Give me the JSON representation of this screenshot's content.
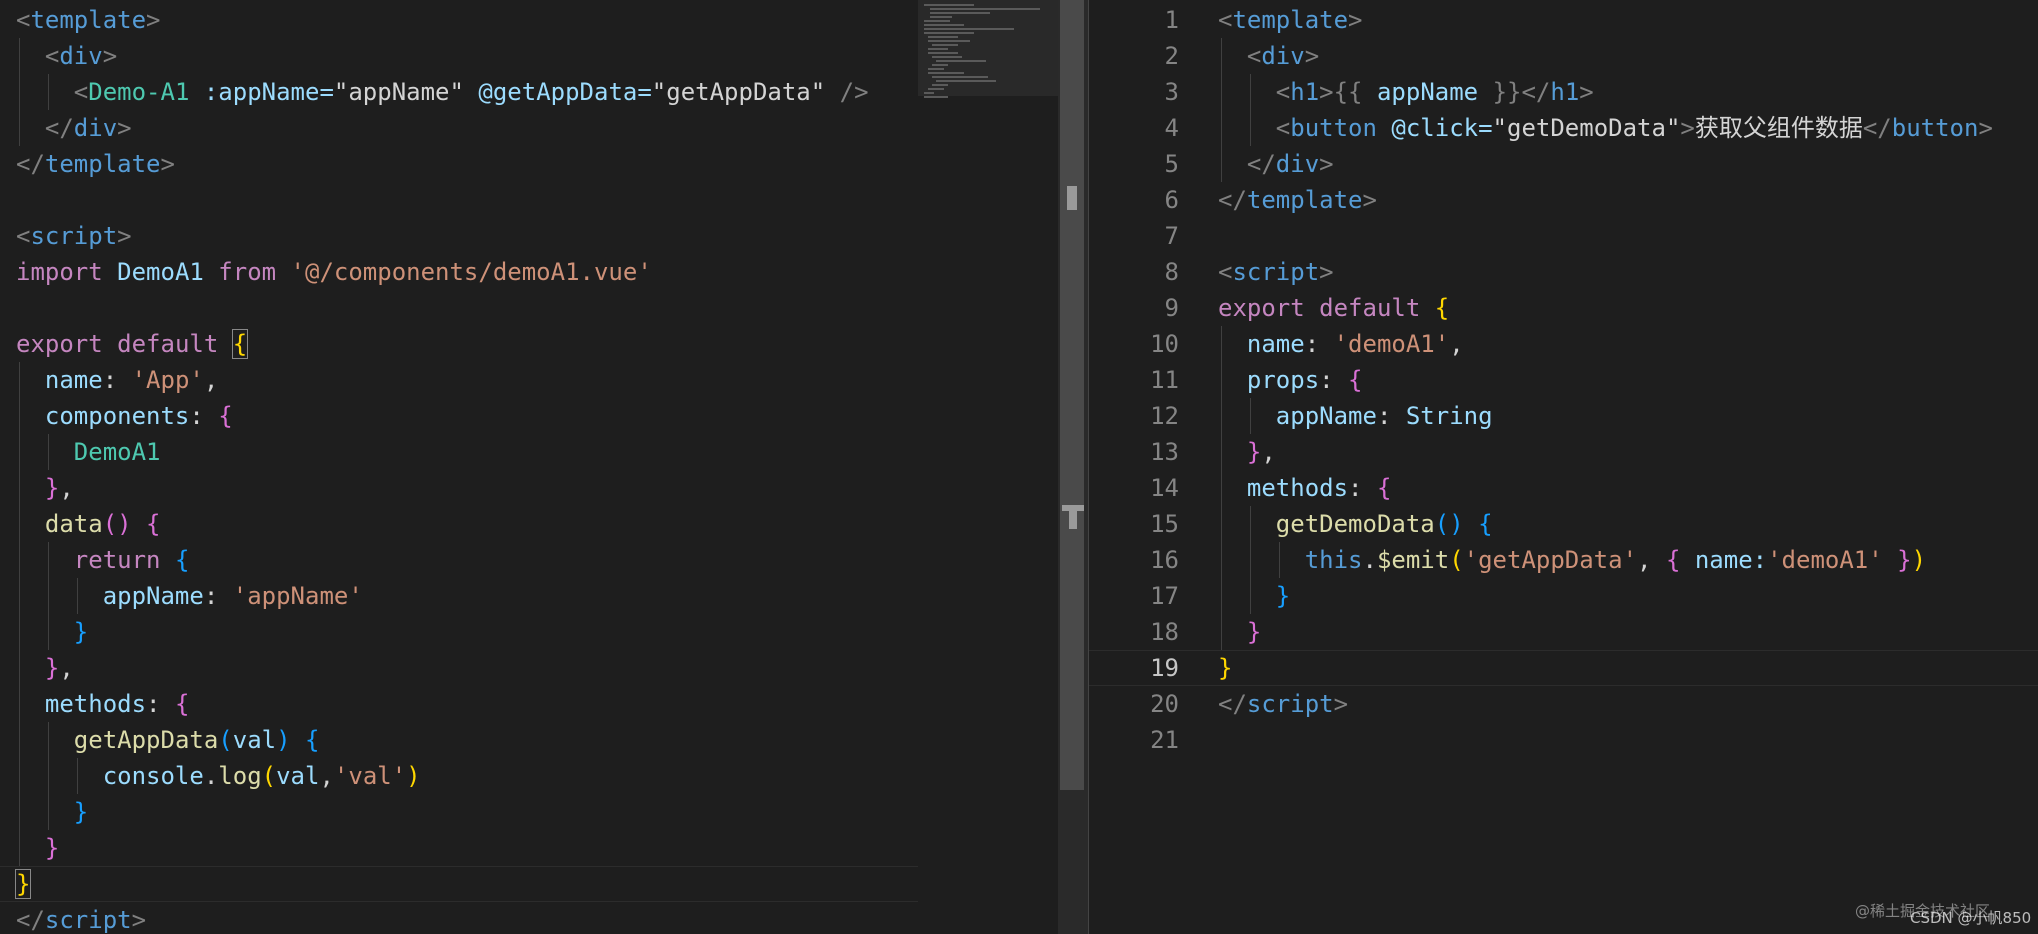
{
  "left_editor": {
    "lines": [
      [
        {
          "t": "<",
          "c": "punct"
        },
        {
          "t": "template",
          "c": "tag"
        },
        {
          "t": ">",
          "c": "punct"
        }
      ],
      [
        {
          "t": "<",
          "c": "punct"
        },
        {
          "t": "div",
          "c": "tag"
        },
        {
          "t": ">",
          "c": "punct"
        }
      ],
      [
        {
          "t": "<",
          "c": "punct"
        },
        {
          "t": "Demo-A1",
          "c": "comp"
        },
        {
          "t": " :appName=",
          "c": "attr"
        },
        {
          "t": "\"appName\"",
          "c": "plain"
        },
        {
          "t": " @getAppData=",
          "c": "attr"
        },
        {
          "t": "\"getAppData\"",
          "c": "plain"
        },
        {
          "t": " />",
          "c": "punct"
        }
      ],
      [
        {
          "t": "</",
          "c": "punct"
        },
        {
          "t": "div",
          "c": "tag"
        },
        {
          "t": ">",
          "c": "punct"
        }
      ],
      [
        {
          "t": "</",
          "c": "punct"
        },
        {
          "t": "template",
          "c": "tag"
        },
        {
          "t": ">",
          "c": "punct"
        }
      ],
      [],
      [
        {
          "t": "<",
          "c": "punct"
        },
        {
          "t": "script",
          "c": "tag"
        },
        {
          "t": ">",
          "c": "punct"
        }
      ],
      [
        {
          "t": "import",
          "c": "kw"
        },
        {
          "t": " DemoA1 ",
          "c": "var"
        },
        {
          "t": "from",
          "c": "kw"
        },
        {
          "t": " '@/components/demoA1.vue'",
          "c": "str"
        }
      ],
      [],
      [
        {
          "t": "export",
          "c": "kw"
        },
        {
          "t": " default ",
          "c": "kw"
        },
        {
          "t": "{",
          "c": "b1",
          "box": true
        }
      ],
      [
        {
          "t": "name",
          "c": "var"
        },
        {
          "t": ": ",
          "c": "plain"
        },
        {
          "t": "'App'",
          "c": "str"
        },
        {
          "t": ",",
          "c": "plain"
        }
      ],
      [
        {
          "t": "components",
          "c": "var"
        },
        {
          "t": ": ",
          "c": "plain"
        },
        {
          "t": "{",
          "c": "b2"
        }
      ],
      [
        {
          "t": "DemoA1",
          "c": "comp"
        }
      ],
      [
        {
          "t": "}",
          "c": "b2"
        },
        {
          "t": ",",
          "c": "plain"
        }
      ],
      [
        {
          "t": "data",
          "c": "fn"
        },
        {
          "t": "()",
          "c": "b2"
        },
        {
          "t": " ",
          "c": "plain"
        },
        {
          "t": "{",
          "c": "b2"
        }
      ],
      [
        {
          "t": "return",
          "c": "kw"
        },
        {
          "t": " ",
          "c": "plain"
        },
        {
          "t": "{",
          "c": "b3"
        }
      ],
      [
        {
          "t": "appName",
          "c": "var"
        },
        {
          "t": ": ",
          "c": "plain"
        },
        {
          "t": "'appName'",
          "c": "str"
        }
      ],
      [
        {
          "t": "}",
          "c": "b3"
        }
      ],
      [
        {
          "t": "}",
          "c": "b2"
        },
        {
          "t": ",",
          "c": "plain"
        }
      ],
      [
        {
          "t": "methods",
          "c": "var"
        },
        {
          "t": ": ",
          "c": "plain"
        },
        {
          "t": "{",
          "c": "b2"
        }
      ],
      [
        {
          "t": "getAppData",
          "c": "fn"
        },
        {
          "t": "(",
          "c": "b3"
        },
        {
          "t": "val",
          "c": "var"
        },
        {
          "t": ")",
          "c": "b3"
        },
        {
          "t": " ",
          "c": "plain"
        },
        {
          "t": "{",
          "c": "b3"
        }
      ],
      [
        {
          "t": "console",
          "c": "var"
        },
        {
          "t": ".",
          "c": "plain"
        },
        {
          "t": "log",
          "c": "fn"
        },
        {
          "t": "(",
          "c": "b1"
        },
        {
          "t": "val",
          "c": "var"
        },
        {
          "t": ",",
          "c": "plain"
        },
        {
          "t": "'val'",
          "c": "str"
        },
        {
          "t": ")",
          "c": "b1"
        }
      ],
      [
        {
          "t": "}",
          "c": "b3"
        }
      ],
      [
        {
          "t": "}",
          "c": "b2"
        }
      ],
      [
        {
          "t": "}",
          "c": "b1",
          "box": true
        }
      ],
      [
        {
          "t": "</",
          "c": "punct"
        },
        {
          "t": "script",
          "c": "tag"
        },
        {
          "t": ">",
          "c": "punct"
        }
      ]
    ]
  },
  "right_editor": {
    "active_line": 19,
    "line_numbers": [
      "1",
      "2",
      "3",
      "4",
      "5",
      "6",
      "7",
      "8",
      "9",
      "10",
      "11",
      "12",
      "13",
      "14",
      "15",
      "16",
      "17",
      "18",
      "19",
      "20",
      "21"
    ],
    "lines": [
      [
        {
          "t": "<",
          "c": "punct"
        },
        {
          "t": "template",
          "c": "tag"
        },
        {
          "t": ">",
          "c": "punct"
        }
      ],
      [
        {
          "t": "<",
          "c": "punct"
        },
        {
          "t": "div",
          "c": "tag"
        },
        {
          "t": ">",
          "c": "punct"
        }
      ],
      [
        {
          "t": "<",
          "c": "punct"
        },
        {
          "t": "h1",
          "c": "tag"
        },
        {
          "t": ">",
          "c": "punct"
        },
        {
          "t": "{{ ",
          "c": "punct"
        },
        {
          "t": "appName",
          "c": "var"
        },
        {
          "t": " }}",
          "c": "punct"
        },
        {
          "t": "</",
          "c": "punct"
        },
        {
          "t": "h1",
          "c": "tag"
        },
        {
          "t": ">",
          "c": "punct"
        }
      ],
      [
        {
          "t": "<",
          "c": "punct"
        },
        {
          "t": "button",
          "c": "tag"
        },
        {
          "t": " @click=",
          "c": "attr"
        },
        {
          "t": "\"getDemoData\"",
          "c": "plain"
        },
        {
          "t": ">",
          "c": "punct"
        },
        {
          "t": "获取父组件数据",
          "c": "plain"
        },
        {
          "t": "</",
          "c": "punct"
        },
        {
          "t": "button",
          "c": "tag"
        },
        {
          "t": ">",
          "c": "punct"
        }
      ],
      [
        {
          "t": "</",
          "c": "punct"
        },
        {
          "t": "div",
          "c": "tag"
        },
        {
          "t": ">",
          "c": "punct"
        }
      ],
      [
        {
          "t": "</",
          "c": "punct"
        },
        {
          "t": "template",
          "c": "tag"
        },
        {
          "t": ">",
          "c": "punct"
        }
      ],
      [],
      [
        {
          "t": "<",
          "c": "punct"
        },
        {
          "t": "script",
          "c": "tag"
        },
        {
          "t": ">",
          "c": "punct"
        }
      ],
      [
        {
          "t": "export",
          "c": "kw"
        },
        {
          "t": " default ",
          "c": "kw"
        },
        {
          "t": "{",
          "c": "b1"
        }
      ],
      [
        {
          "t": "name",
          "c": "var"
        },
        {
          "t": ": ",
          "c": "plain"
        },
        {
          "t": "'demoA1'",
          "c": "str"
        },
        {
          "t": ",",
          "c": "plain"
        }
      ],
      [
        {
          "t": "props",
          "c": "var"
        },
        {
          "t": ": ",
          "c": "plain"
        },
        {
          "t": "{",
          "c": "b2"
        }
      ],
      [
        {
          "t": "appName",
          "c": "var"
        },
        {
          "t": ": ",
          "c": "plain"
        },
        {
          "t": "String",
          "c": "var"
        }
      ],
      [
        {
          "t": "}",
          "c": "b2"
        },
        {
          "t": ",",
          "c": "plain"
        }
      ],
      [
        {
          "t": "methods",
          "c": "var"
        },
        {
          "t": ": ",
          "c": "plain"
        },
        {
          "t": "{",
          "c": "b2"
        }
      ],
      [
        {
          "t": "getDemoData",
          "c": "fn"
        },
        {
          "t": "()",
          "c": "b3"
        },
        {
          "t": " ",
          "c": "plain"
        },
        {
          "t": "{",
          "c": "b3"
        }
      ],
      [
        {
          "t": "this",
          "c": "kw2"
        },
        {
          "t": ".",
          "c": "plain"
        },
        {
          "t": "$emit",
          "c": "fn"
        },
        {
          "t": "(",
          "c": "b1"
        },
        {
          "t": "'getAppData'",
          "c": "str"
        },
        {
          "t": ", ",
          "c": "plain"
        },
        {
          "t": "{",
          "c": "b2"
        },
        {
          "t": " name:",
          "c": "var"
        },
        {
          "t": "'demoA1'",
          "c": "str"
        },
        {
          "t": " ",
          "c": "plain"
        },
        {
          "t": "}",
          "c": "b2"
        },
        {
          "t": ")",
          "c": "b1"
        }
      ],
      [
        {
          "t": "}",
          "c": "b3"
        }
      ],
      [
        {
          "t": "}",
          "c": "b2"
        }
      ],
      [
        {
          "t": "}",
          "c": "b1"
        }
      ],
      [
        {
          "t": "</",
          "c": "punct"
        },
        {
          "t": "script",
          "c": "tag"
        },
        {
          "t": ">",
          "c": "punct"
        }
      ],
      []
    ]
  },
  "watermark": {
    "text_back": "@稀土掘金技术社区",
    "text_front": "CSDN @小帆850"
  }
}
